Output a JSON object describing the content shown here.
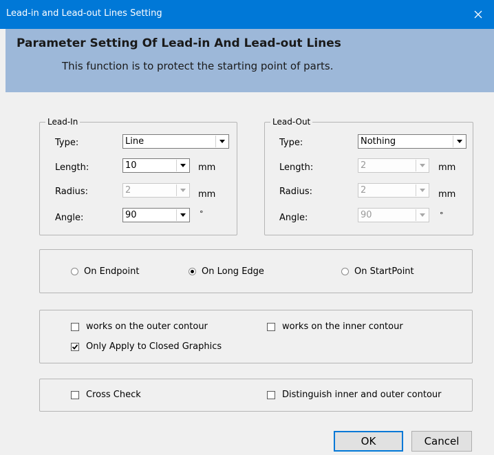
{
  "window": {
    "title": "Lead-in and Lead-out Lines Setting"
  },
  "banner": {
    "heading": "Parameter Setting Of Lead-in And Lead-out Lines",
    "subtitle": "This function is to protect the starting point of parts."
  },
  "lead_in": {
    "legend": "Lead-In",
    "type_label": "Type:",
    "type_value": "Line",
    "length_label": "Length:",
    "length_value": "10",
    "length_unit": "mm",
    "radius_label": "Radius:",
    "radius_value": "2",
    "radius_unit": "mm",
    "angle_label": "Angle:",
    "angle_value": "90",
    "angle_unit": "°"
  },
  "lead_out": {
    "legend": "Lead-Out",
    "type_label": "Type:",
    "type_value": "Nothing",
    "length_label": "Length:",
    "length_value": "2",
    "length_unit": "mm",
    "radius_label": "Radius:",
    "radius_value": "2",
    "radius_unit": "mm",
    "angle_label": "Angle:",
    "angle_value": "90",
    "angle_unit": "°"
  },
  "position": {
    "options": [
      "On Endpoint",
      "On Long Edge",
      "On StartPoint"
    ],
    "selected": "On Long Edge"
  },
  "contour": {
    "outer_label": "works on the outer contour",
    "outer_checked": false,
    "inner_label": "works on the inner contour",
    "inner_checked": false,
    "closed_label": "Only Apply to Closed Graphics",
    "closed_checked": true
  },
  "checks": {
    "cross_label": "Cross Check",
    "cross_checked": false,
    "distinguish_label": "Distinguish inner and outer contour",
    "distinguish_checked": false
  },
  "buttons": {
    "ok": "OK",
    "cancel": "Cancel"
  },
  "colors": {
    "titlebar": "#0078d7",
    "banner": "#9db8d9",
    "dialog_bg": "#f0f0f0"
  }
}
